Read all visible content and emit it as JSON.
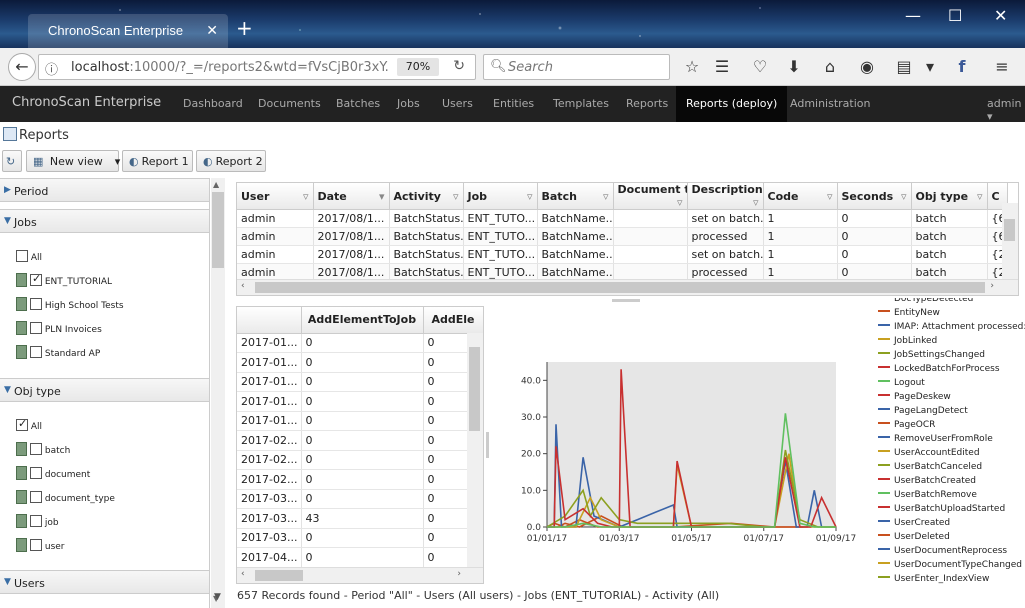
{
  "browser": {
    "tab_title": "ChronoScan Enterprise",
    "url_host": "localhost",
    "url_rest": ":10000/?_=/reports2&wtd=fVsCjB0r3xY.",
    "zoom": "70%",
    "search_placeholder": "Search"
  },
  "app": {
    "brand": "ChronoScan Enterprise",
    "nav": [
      "Dashboard",
      "Documents",
      "Batches",
      "Jobs",
      "Users",
      "Entities",
      "Templates",
      "Reports",
      "Reports (deploy)",
      "Administration"
    ],
    "active_nav": "Reports (deploy)",
    "user_menu": "admin"
  },
  "page": {
    "title": "Reports",
    "toolbar": {
      "new_view": "New view",
      "report1": "Report 1",
      "report2": "Report 2"
    }
  },
  "filters": {
    "period": "Period",
    "jobs": {
      "label": "Jobs",
      "items": [
        {
          "label": "All",
          "checked": false
        },
        {
          "label": "ENT_TUTORIAL",
          "checked": true
        },
        {
          "label": "High School Tests",
          "checked": false
        },
        {
          "label": "PLN Invoices",
          "checked": false
        },
        {
          "label": "Standard AP",
          "checked": false
        }
      ]
    },
    "obj_type": {
      "label": "Obj type",
      "items": [
        {
          "label": "All",
          "checked": true
        },
        {
          "label": "batch",
          "checked": false
        },
        {
          "label": "document",
          "checked": false
        },
        {
          "label": "document_type",
          "checked": false
        },
        {
          "label": "job",
          "checked": false
        },
        {
          "label": "user",
          "checked": false
        }
      ]
    },
    "users": "Users"
  },
  "top_grid": {
    "columns": [
      "User",
      "Date",
      "Activity",
      "Job",
      "Batch",
      "Document ty",
      "Description",
      "Code",
      "Seconds",
      "Obj type",
      "C"
    ],
    "rows": [
      [
        "admin",
        "2017/08/1...",
        "BatchStatus...",
        "ENT_TUTO...",
        "BatchName...",
        "",
        "set on batch...",
        "1",
        "0",
        "batch",
        "{6"
      ],
      [
        "admin",
        "2017/08/1...",
        "BatchStatus...",
        "ENT_TUTO...",
        "BatchName...",
        "",
        "processed",
        "1",
        "0",
        "batch",
        "{6"
      ],
      [
        "admin",
        "2017/08/1...",
        "BatchStatus...",
        "ENT_TUTO...",
        "BatchName...",
        "",
        "set on batch...",
        "1",
        "0",
        "batch",
        "{2"
      ],
      [
        "admin",
        "2017/08/1...",
        "BatchStatus...",
        "ENT_TUTO...",
        "BatchName...",
        "",
        "processed",
        "1",
        "0",
        "batch",
        "{2"
      ],
      [
        "admin",
        "2017/08/1...",
        "BatchStatus...",
        "ENT_TUTO...",
        "BatchName...",
        "",
        "",
        "1",
        "0",
        "batch",
        ""
      ]
    ]
  },
  "bottom_grid": {
    "columns": [
      "",
      "AddElementToJob",
      "AddEle"
    ],
    "rows": [
      [
        "2017-01...",
        "0",
        "0"
      ],
      [
        "2017-01...",
        "0",
        "0"
      ],
      [
        "2017-01...",
        "0",
        "0"
      ],
      [
        "2017-01...",
        "0",
        "0"
      ],
      [
        "2017-01...",
        "0",
        "0"
      ],
      [
        "2017-02...",
        "0",
        "0"
      ],
      [
        "2017-02...",
        "0",
        "0"
      ],
      [
        "2017-02...",
        "0",
        "0"
      ],
      [
        "2017-03...",
        "0",
        "0"
      ],
      [
        "2017-03...",
        "43",
        "0"
      ],
      [
        "2017-03...",
        "0",
        "0"
      ],
      [
        "2017-04...",
        "0",
        "0"
      ]
    ]
  },
  "chart_data": {
    "type": "line",
    "x_ticks": [
      "01/01/17",
      "01/03/17",
      "01/05/17",
      "01/07/17",
      "01/09/17"
    ],
    "y_ticks": [
      "0.0",
      "10.0",
      "20.0",
      "30.0",
      "40.0"
    ],
    "xlim": [
      0,
      8
    ],
    "ylim": [
      0,
      45
    ],
    "grid": false,
    "legend_placement": "right",
    "series": [
      {
        "name": "DocTypeDetected",
        "color": "#c8501e",
        "x": [
          0,
          0.2,
          0.5,
          0.9,
          1.4,
          2.0,
          3.5,
          5.0,
          6.3,
          7.0
        ],
        "y": [
          0,
          1,
          0,
          2,
          0,
          0,
          0,
          0,
          0,
          0
        ]
      },
      {
        "name": "EntityNew",
        "color": "#c8501e",
        "x": [
          0,
          0.3,
          0.5,
          0.9,
          1.5,
          2.1,
          3.5,
          5.1,
          6.3,
          7.1
        ],
        "y": [
          0,
          0,
          1,
          0,
          3,
          0,
          0,
          1,
          0,
          0
        ]
      },
      {
        "name": "IMAP: Attachment processed:",
        "color": "#3a64a8",
        "x": [
          0,
          0.2,
          0.25,
          0.4,
          0.8,
          1.0,
          1.3,
          2.0,
          2.5,
          3.0,
          3.5,
          3.6,
          4.0,
          5.0,
          6.0,
          6.3,
          6.6,
          6.9,
          7.2,
          7.4,
          7.6,
          7.8,
          8.0
        ],
        "y": [
          0,
          0,
          28,
          0,
          0,
          19,
          3,
          0,
          2,
          4,
          6,
          0,
          0,
          0,
          0,
          0,
          18,
          0,
          0,
          10,
          0,
          0,
          0
        ]
      },
      {
        "name": "JobLinked",
        "color": "#c8a020",
        "x": [
          0,
          0.8,
          1.2,
          1.5,
          2.0,
          3.5,
          3.6,
          4.0,
          5.0,
          6.3,
          6.7,
          7.0,
          8.0
        ],
        "y": [
          0,
          0,
          8,
          2,
          0,
          0,
          17,
          0,
          0,
          0,
          20,
          0,
          0
        ]
      },
      {
        "name": "JobSettingsChanged",
        "color": "#8ca020",
        "x": [
          0,
          0.5,
          1.0,
          1.2,
          1.5,
          2.0,
          2.5,
          3.5,
          5.0,
          6.0,
          6.3,
          6.6,
          7.0,
          7.5,
          8.0
        ],
        "y": [
          0,
          3,
          10,
          3,
          8,
          2,
          1,
          1,
          1,
          0,
          0,
          21,
          2,
          0,
          0
        ]
      },
      {
        "name": "LockedBatchForProcess",
        "color": "#c83030",
        "x": [
          0,
          0.2,
          0.25,
          0.5,
          1.0,
          1.4,
          1.8,
          2.0,
          2.05,
          2.3,
          3.5,
          3.6,
          4.0,
          6.3,
          6.6,
          7.0,
          7.3,
          7.6,
          8.0
        ],
        "y": [
          0,
          0,
          22,
          2,
          5,
          1,
          0,
          0,
          43,
          0,
          0,
          18,
          0,
          0,
          19,
          0,
          0,
          8,
          0
        ]
      },
      {
        "name": "Logout",
        "color": "#60c060",
        "x": [
          0,
          0.5,
          1.0,
          1.5,
          2.0,
          3.0,
          5.0,
          6.3,
          6.6,
          7.0,
          7.4,
          7.6,
          8.0
        ],
        "y": [
          0,
          0,
          1,
          0,
          0,
          0,
          0,
          0,
          31,
          1,
          0,
          0,
          0
        ]
      },
      {
        "name": "PageDeskew",
        "color": "#c83030"
      },
      {
        "name": "PageLangDetect",
        "color": "#3a64a8"
      },
      {
        "name": "PageOCR",
        "color": "#c8501e"
      },
      {
        "name": "RemoveUserFromRole",
        "color": "#3a64a8"
      },
      {
        "name": "UserAccountEdited",
        "color": "#c8a020"
      },
      {
        "name": "UserBatchCanceled",
        "color": "#8ca020"
      },
      {
        "name": "UserBatchCreated",
        "color": "#c83030"
      },
      {
        "name": "UserBatchRemove",
        "color": "#60c060"
      },
      {
        "name": "UserBatchUploadStarted",
        "color": "#c83030"
      },
      {
        "name": "UserCreated",
        "color": "#3a64a8"
      },
      {
        "name": "UserDeleted",
        "color": "#c8501e"
      },
      {
        "name": "UserDocumentReprocess",
        "color": "#3a64a8"
      },
      {
        "name": "UserDocumentTypeChanged",
        "color": "#c8a020"
      },
      {
        "name": "UserEnter_IndexView",
        "color": "#8ca020"
      }
    ]
  },
  "status_text": "657 Records found - Period \"All\" - Users (All users) - Jobs (ENT_TUTORIAL) - Activity (All)"
}
